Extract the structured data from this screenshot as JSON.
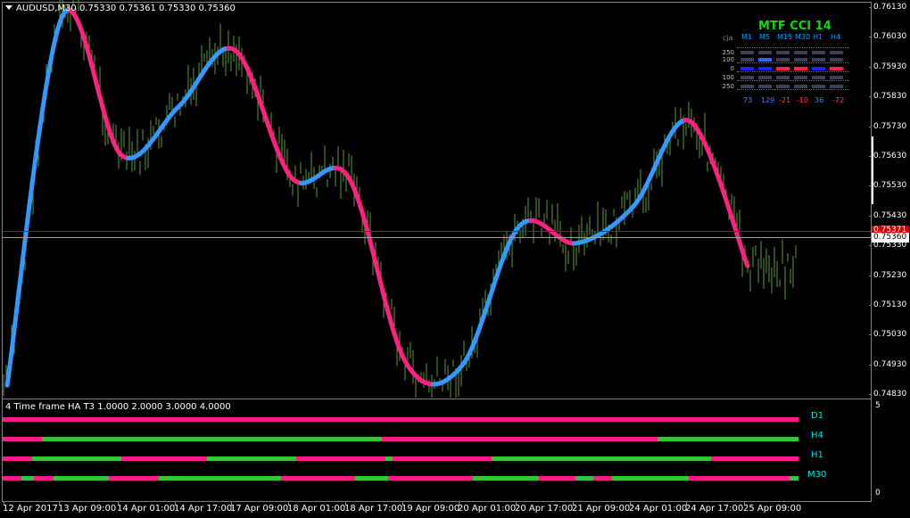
{
  "chart_title": "AUDUSD,M30 0.75330 0.75361 0.75330 0.75360",
  "price_axis": [
    "0.76130",
    "0.76030",
    "0.75930",
    "0.75830",
    "0.75730",
    "0.75630",
    "0.75530",
    "0.75430",
    "0.75330",
    "0.75230",
    "0.75130",
    "0.75030",
    "0.74930",
    "0.74830"
  ],
  "current_price": "0.75360",
  "ask_price": "0.75371",
  "sub_title": "4 Time frame HA T3 1.0000 2.0000 3.0000 4.0000",
  "sub_axis": {
    "top": "5",
    "bottom": "0"
  },
  "time_axis": [
    "12 Apr 2017",
    "13 Apr 09:00",
    "14 Apr 01:00",
    "14 Apr 17:00",
    "17 Apr 09:00",
    "18 Apr 01:00",
    "18 Apr 17:00",
    "19 Apr 09:00",
    "20 Apr 01:00",
    "20 Apr 17:00",
    "21 Apr 09:00",
    "24 Apr 01:00",
    "24 Apr 17:00",
    "25 Apr 09:00"
  ],
  "timeframes": [
    "D1",
    "H4",
    "H1",
    "M30"
  ],
  "cci_panel": {
    "title": "MTF CCI  14",
    "symbol_label": "cja",
    "columns": [
      "M1",
      "M5",
      "M15",
      "M30",
      "H1",
      "H4"
    ],
    "levels": [
      "250",
      "100",
      "0",
      "100",
      "250"
    ],
    "values": [
      "73",
      "129",
      "-21",
      "-10",
      "36",
      "-72"
    ],
    "value_colors": [
      "#4080ff",
      "#4080ff",
      "#ff4040",
      "#ff4040",
      "#4080ff",
      "#ff4040"
    ]
  },
  "colors": {
    "bull": "#ff1a8c",
    "bear": "#33c833",
    "up_line": "#3399ff",
    "down_line": "#ff2080",
    "candles": "#5a9a3a",
    "ask_line": "#cc0000"
  },
  "chart_data": {
    "type": "line",
    "title": "AUDUSD,M30 0.75330 0.75361 0.75330 0.75360",
    "xlabel": "",
    "ylabel": "",
    "x": [
      "12 Apr 2017",
      "13 Apr 09:00",
      "14 Apr 01:00",
      "14 Apr 17:00",
      "17 Apr 09:00",
      "18 Apr 01:00",
      "18 Apr 17:00",
      "19 Apr 09:00",
      "20 Apr 01:00",
      "20 Apr 17:00",
      "21 Apr 09:00",
      "24 Apr 01:00",
      "24 Apr 17:00",
      "25 Apr 09:00"
    ],
    "ylim": [
      0.7478,
      0.7616
    ],
    "series": [
      {
        "values": [
          0.7482,
          0.7612,
          0.7563,
          0.758,
          0.76,
          0.7555,
          0.7555,
          0.749,
          0.7489,
          0.7538,
          0.7532,
          0.7545,
          0.7575,
          0.7524
        ]
      }
    ]
  }
}
